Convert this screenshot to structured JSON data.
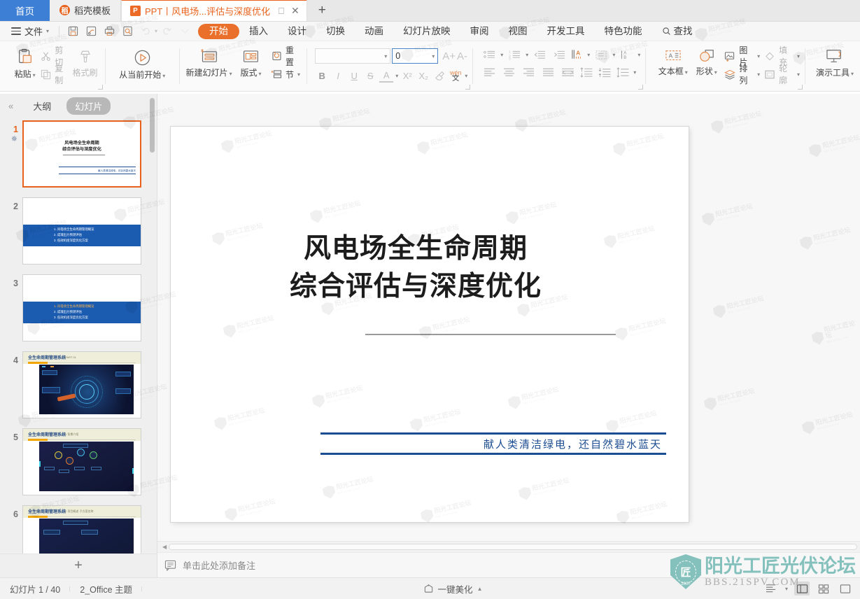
{
  "window": {
    "tabs": [
      {
        "label": "首页",
        "kind": "home",
        "icon": "home-tab"
      },
      {
        "label": "稻壳模板",
        "kind": "template",
        "icon": "docer-icon"
      },
      {
        "label": "PPT丨风电场...评估与深度优化",
        "kind": "document",
        "icon": "ppt-file-icon",
        "active": true
      }
    ],
    "new_tab_label": "+"
  },
  "menubar": {
    "file_label": "文件",
    "quick_access": [
      "save-icon",
      "save-as-icon",
      "print-icon",
      "print-preview-icon",
      "undo-icon",
      "redo-icon",
      "customize-icon"
    ],
    "items": [
      {
        "label": "开始",
        "selected": true
      },
      {
        "label": "插入",
        "selected": false
      },
      {
        "label": "设计",
        "selected": false
      },
      {
        "label": "切换",
        "selected": false
      },
      {
        "label": "动画",
        "selected": false
      },
      {
        "label": "幻灯片放映",
        "selected": false
      },
      {
        "label": "审阅",
        "selected": false
      },
      {
        "label": "视图",
        "selected": false
      },
      {
        "label": "开发工具",
        "selected": false
      },
      {
        "label": "特色功能",
        "selected": false
      }
    ],
    "search_label": "查找",
    "accent_color": "#ea6f2a"
  },
  "ribbon": {
    "clipboard": {
      "paste_label": "粘贴",
      "cut_label": "剪切",
      "copy_label": "复制",
      "format_painter_label": "格式刷"
    },
    "slideshow": {
      "from_current_label": "从当前开始"
    },
    "slides": {
      "new_slide_label": "新建幻灯片",
      "layout_label": "版式",
      "reset_label": "重置",
      "section_label": "节"
    },
    "font": {
      "font_name_value": "",
      "font_size_value": "0",
      "grow_font_label": "A+",
      "shrink_font_label": "A-",
      "bold_label": "B",
      "italic_label": "I",
      "underline_label": "U",
      "strikethrough_label": "S",
      "font_color_label": "A",
      "superscript_label": "X²",
      "subscript_label": "X₂",
      "clear_format_label": "clear-format-icon",
      "pinyin_label": "文"
    },
    "paragraph": {
      "bullets_label": "bullet-list-icon",
      "numbering_label": "numbered-list-icon",
      "decrease_indent_label": "decrease-indent-icon",
      "increase_indent_label": "increase-indent-icon",
      "text_direction_label": "text-direction-icon",
      "align_text_label": "align-text-icon",
      "convert_smartart_label": "smartart-icon",
      "align_left_label": "align-left-icon",
      "align_center_label": "align-center-icon",
      "align_right_label": "align-right-icon",
      "justify_label": "justify-icon",
      "distribute_label": "distribute-icon",
      "line_spacing_label": "line-spacing-icon",
      "paragraph_spacing_label": "paragraph-spacing-icon",
      "spacing_more_label": "spacing-more-icon"
    },
    "drawing": {
      "textbox_label": "文本框",
      "shapes_label": "形状",
      "picture_label": "图片",
      "arrange_label": "排列",
      "fill_label": "填充",
      "outline_label": "轮廓"
    },
    "tools": {
      "present_tools_label": "演示工具"
    }
  },
  "left_panel": {
    "collapse_label": "«",
    "tab_outline_label": "大纲",
    "tab_slides_label": "幻灯片",
    "selected_tab": "幻灯片",
    "add_slide_label": "+",
    "thumbnails": [
      {
        "number": "1",
        "selected": true,
        "has_animation": true,
        "type": "title",
        "title_line1": "风电场全生命周期",
        "title_line2": "综合评估与深度优化",
        "subtitle": "献人类清洁绿电，还自然碧水蓝天"
      },
      {
        "number": "2",
        "selected": false,
        "type": "agenda",
        "items": [
          "1. 风电场全生命周期管理概览",
          "2. 成瑰出力预测评估",
          "3. 低效机组深度优化方案"
        ],
        "highlight_index": -1
      },
      {
        "number": "3",
        "selected": false,
        "type": "agenda",
        "items": [
          "1. 风电场全生命周期管理概览",
          "2. 成瑰出力预测评估",
          "3. 低效机组深度优化方案"
        ],
        "highlight_index": 0
      },
      {
        "number": "4",
        "selected": false,
        "type": "content",
        "header": "全生命周期管理系统",
        "sub": "PART 01",
        "image": "dark-globe-dashboard"
      },
      {
        "number": "5",
        "selected": false,
        "type": "content",
        "header": "全生命周期管理系统",
        "sub": "1 背景介绍",
        "image": "dark-network-map"
      },
      {
        "number": "6",
        "selected": false,
        "type": "content",
        "header": "全生命周期管理系统",
        "sub": "2 项目概述 子方案名称",
        "image": "dark-project-diagram"
      }
    ]
  },
  "slide": {
    "title_line1": "风电场全生命周期",
    "title_line2": "综合评估与深度优化",
    "subtitle": "献人类清洁绿电，还自然碧水蓝天",
    "title_color": "#1c1c1c",
    "accent_color": "#1c4d92"
  },
  "notes": {
    "placeholder": "单击此处添加备注",
    "icon": "notes-icon"
  },
  "statusbar": {
    "slide_counter": "幻灯片 1 / 40",
    "theme_name": "2_Office 主题",
    "beautify_label": "一键美化",
    "beautify_icon": "magic-icon",
    "views": [
      "outline-view-icon",
      "normal-view-icon",
      "slide-sorter-icon",
      "reading-view-icon"
    ],
    "selected_view": "normal-view-icon"
  },
  "watermark": {
    "brand_cn": "阳光工匠光伏论坛",
    "brand_url": "BBS.21SPV.COM",
    "year": "2007",
    "logo_char": "匠",
    "color": "#7cbdb8"
  }
}
